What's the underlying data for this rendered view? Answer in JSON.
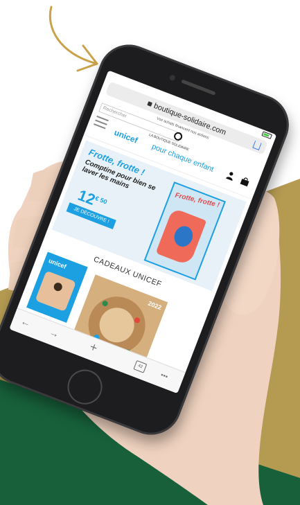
{
  "colors": {
    "gold": "#b59a52",
    "green": "#17603a",
    "unicef_blue": "#1ca0e1",
    "arrow_gold": "#c9a24a"
  },
  "browser": {
    "url": "boutique-solidaire.com",
    "back_icon": "back-arrow-icon",
    "forward_icon": "forward-arrow-icon",
    "new_tab_icon": "plus-icon",
    "tabs_count": "42",
    "more_label": "•••"
  },
  "site": {
    "promo": "Vos achats financent nos actions",
    "search_placeholder": "Rechercher",
    "boutique_label": "LA BOUTIQUE SOLIDAIRE",
    "logo": "unicef",
    "tagline": "pour chaque enfant"
  },
  "hero": {
    "title": "Frotte, frotte !",
    "subtitle": "Comptine pour bien se laver les mains",
    "price": "12",
    "price_cents": "€ 50",
    "cta": "JE DÉCOUVRE !",
    "book_title": "Frotte, frotte !"
  },
  "section": {
    "title": "CADEAUX UNICEF"
  },
  "products": {
    "card1_label": "unicef",
    "card2_year": "2022"
  }
}
